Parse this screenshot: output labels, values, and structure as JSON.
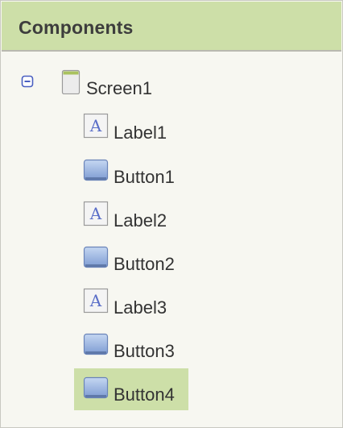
{
  "panel": {
    "title": "Components"
  },
  "tree": {
    "root": {
      "label": "Screen1",
      "icon": "screen-icon",
      "expanded": true
    },
    "children": [
      {
        "label": "Label1",
        "icon": "label-icon",
        "selected": false
      },
      {
        "label": "Button1",
        "icon": "button-icon",
        "selected": false
      },
      {
        "label": "Label2",
        "icon": "label-icon",
        "selected": false
      },
      {
        "label": "Button2",
        "icon": "button-icon",
        "selected": false
      },
      {
        "label": "Label3",
        "icon": "label-icon",
        "selected": false
      },
      {
        "label": "Button3",
        "icon": "button-icon",
        "selected": false
      },
      {
        "label": "Button4",
        "icon": "button-icon",
        "selected": true
      }
    ]
  },
  "colors": {
    "header_bg": "#cddfa8",
    "panel_bg": "#f7f7f1",
    "selected_bg": "#cddfa8",
    "toggle_blue": "#4a5fc1"
  }
}
